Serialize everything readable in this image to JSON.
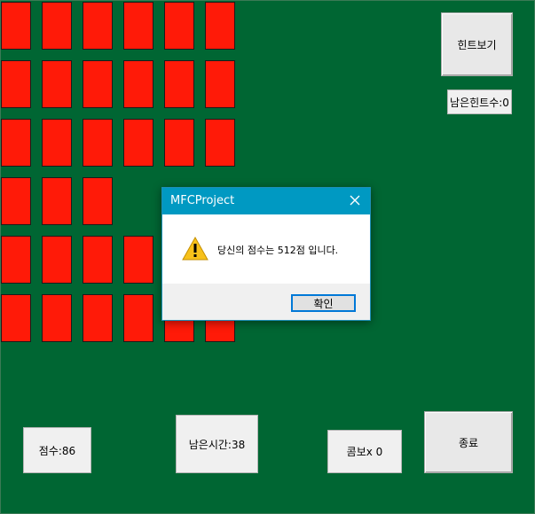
{
  "hint_button": {
    "label": "힌트보기"
  },
  "hints_remaining": {
    "text": "남은힌트수:0"
  },
  "score": {
    "text": "점수:86"
  },
  "time_remaining": {
    "text": "남은시간:38"
  },
  "combo": {
    "text": "콤보x 0"
  },
  "quit_button": {
    "label": "종료"
  },
  "dialog": {
    "title": "MFCProject",
    "message": "당신의 점수는 512점 입니다.",
    "ok_label": "확인",
    "icon": "warning-icon"
  },
  "colors": {
    "felt": "#006633",
    "card_back": "#ff1a08",
    "dialog_title": "#0099c2"
  }
}
